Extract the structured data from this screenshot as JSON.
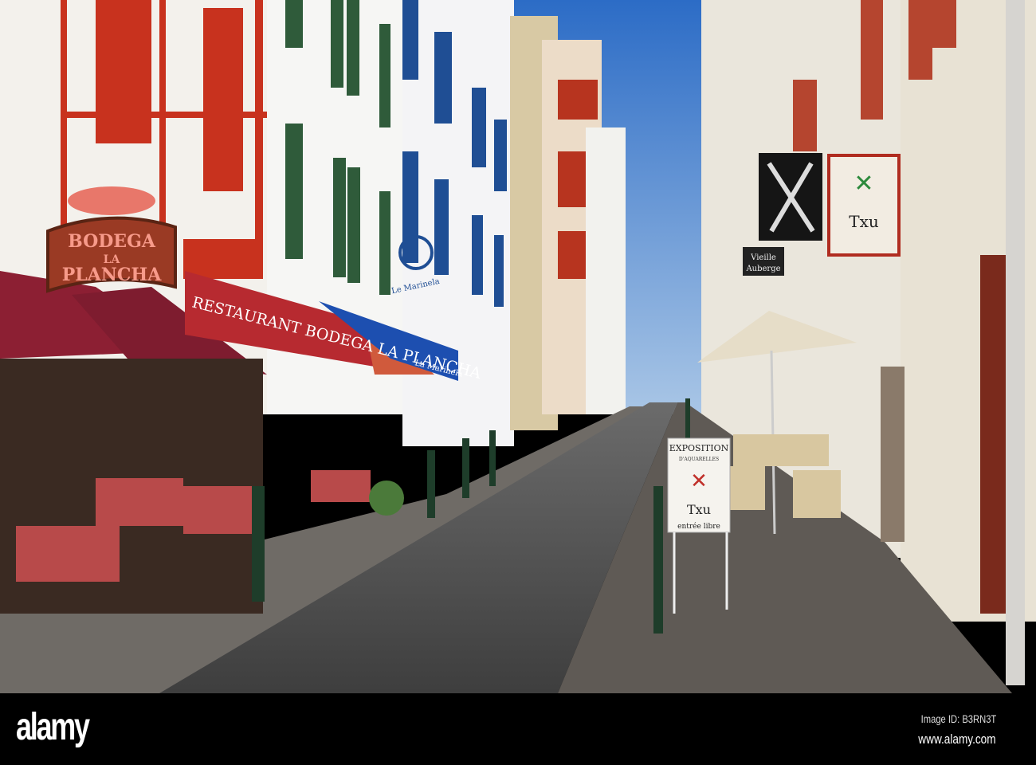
{
  "photo": {
    "signs": {
      "bodega_line1": "BODEGA",
      "bodega_line2": "LA",
      "bodega_line3": "PLANCHA",
      "awning_restaurant": "RESTAURANT BODEGA LA PLANCHA",
      "marinela_plaque": "Le Marinela",
      "marinela_awning": "La Marinela",
      "txu_hanging": "Txu",
      "vieille_line1": "Vieille",
      "vieille_line2": "Auberge",
      "expo_title": "EXPOSITION",
      "expo_sub": "D'AQUARELLES",
      "expo_name": "Txu",
      "expo_footer": "entrée libre"
    },
    "colors": {
      "sky": "#3f7fd0",
      "timber_red": "#c8321e",
      "shutter_green": "#2f5b3a",
      "shutter_blue": "#1f4e94",
      "awning_red": "#a8263a",
      "awning_blue": "#1d4fb0"
    }
  },
  "footer": {
    "logo": "alamy",
    "image_id": "Image ID: B3RN3T",
    "site": "www.alamy.com"
  }
}
